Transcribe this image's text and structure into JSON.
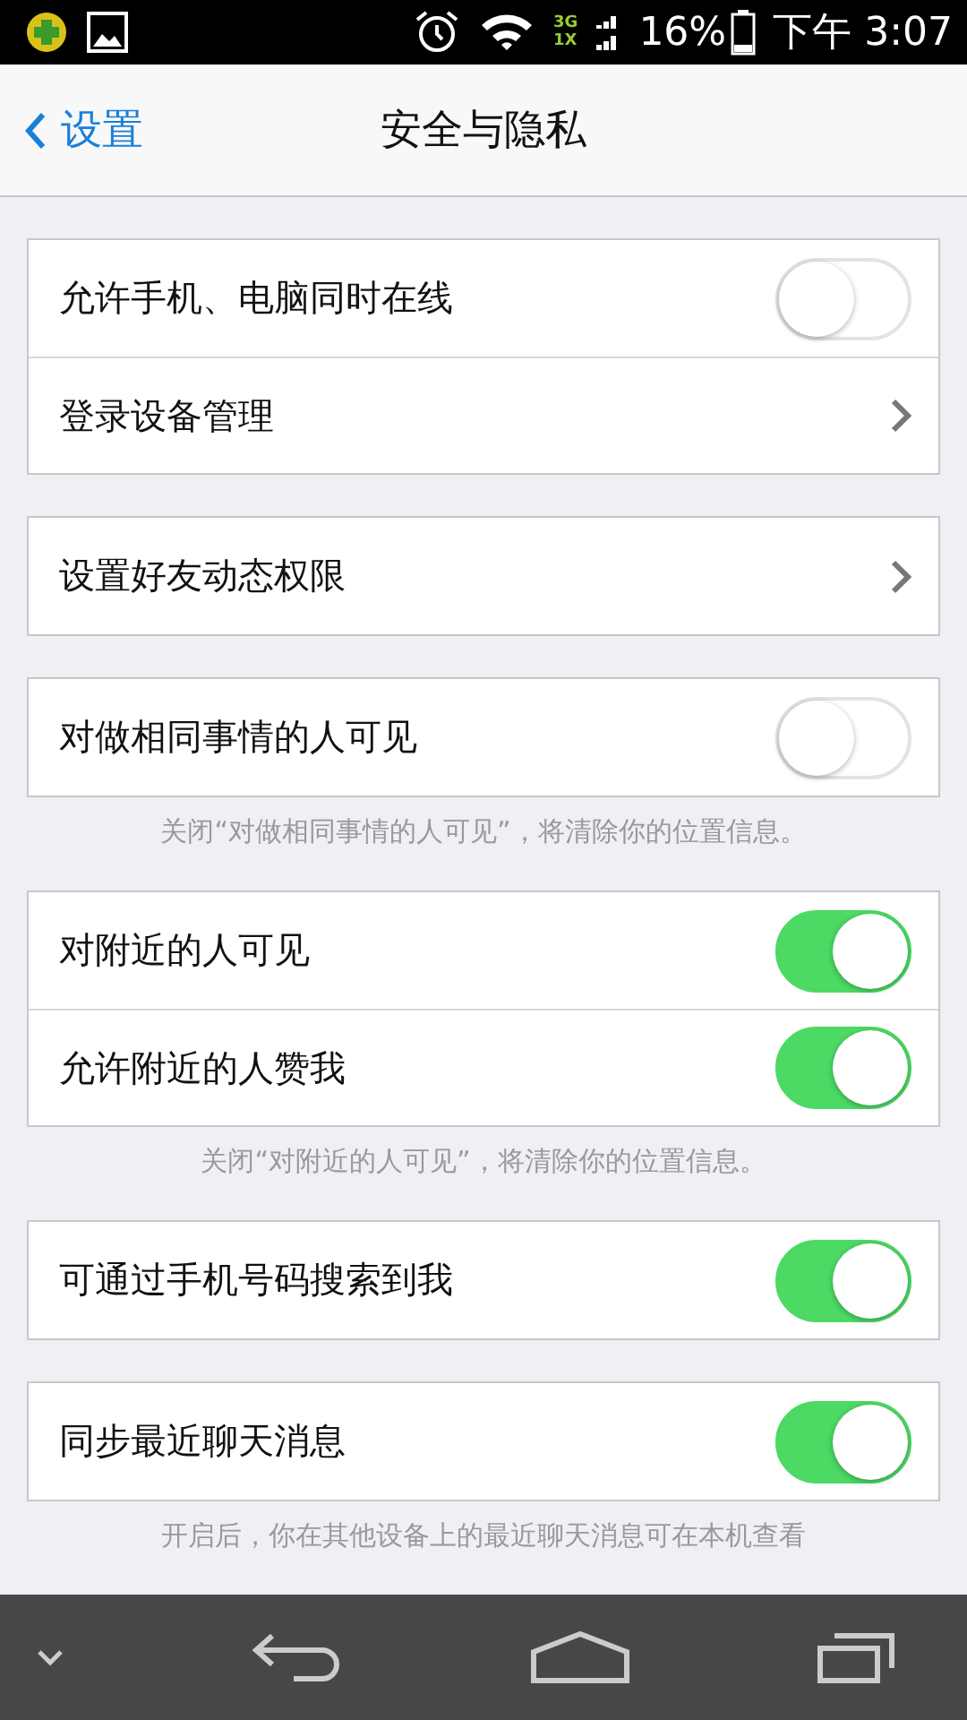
{
  "status_bar": {
    "network_3g": "3G",
    "network_1x": "1X",
    "battery": "16%",
    "time": "下午 3:07"
  },
  "header": {
    "back": "设置",
    "title": "安全与隐私"
  },
  "groups": [
    {
      "rows": [
        {
          "label": "允许手机、电脑同时在线",
          "kind": "toggle",
          "on": false
        },
        {
          "label": "登录设备管理",
          "kind": "link"
        }
      ]
    },
    {
      "rows": [
        {
          "label": "设置好友动态权限",
          "kind": "link"
        }
      ]
    },
    {
      "rows": [
        {
          "label": "对做相同事情的人可见",
          "kind": "toggle",
          "on": false
        }
      ],
      "footnote": "关闭“对做相同事情的人可见”，将清除你的位置信息。"
    },
    {
      "rows": [
        {
          "label": "对附近的人可见",
          "kind": "toggle",
          "on": true
        },
        {
          "label": "允许附近的人赞我",
          "kind": "toggle",
          "on": true
        }
      ],
      "footnote": "关闭“对附近的人可见”，将清除你的位置信息。"
    },
    {
      "rows": [
        {
          "label": "可通过手机号码搜索到我",
          "kind": "toggle",
          "on": true
        }
      ]
    },
    {
      "rows": [
        {
          "label": "同步最近聊天消息",
          "kind": "toggle",
          "on": true
        }
      ],
      "footnote": "开启后，你在其他设备上的最近聊天消息可在本机查看"
    }
  ]
}
